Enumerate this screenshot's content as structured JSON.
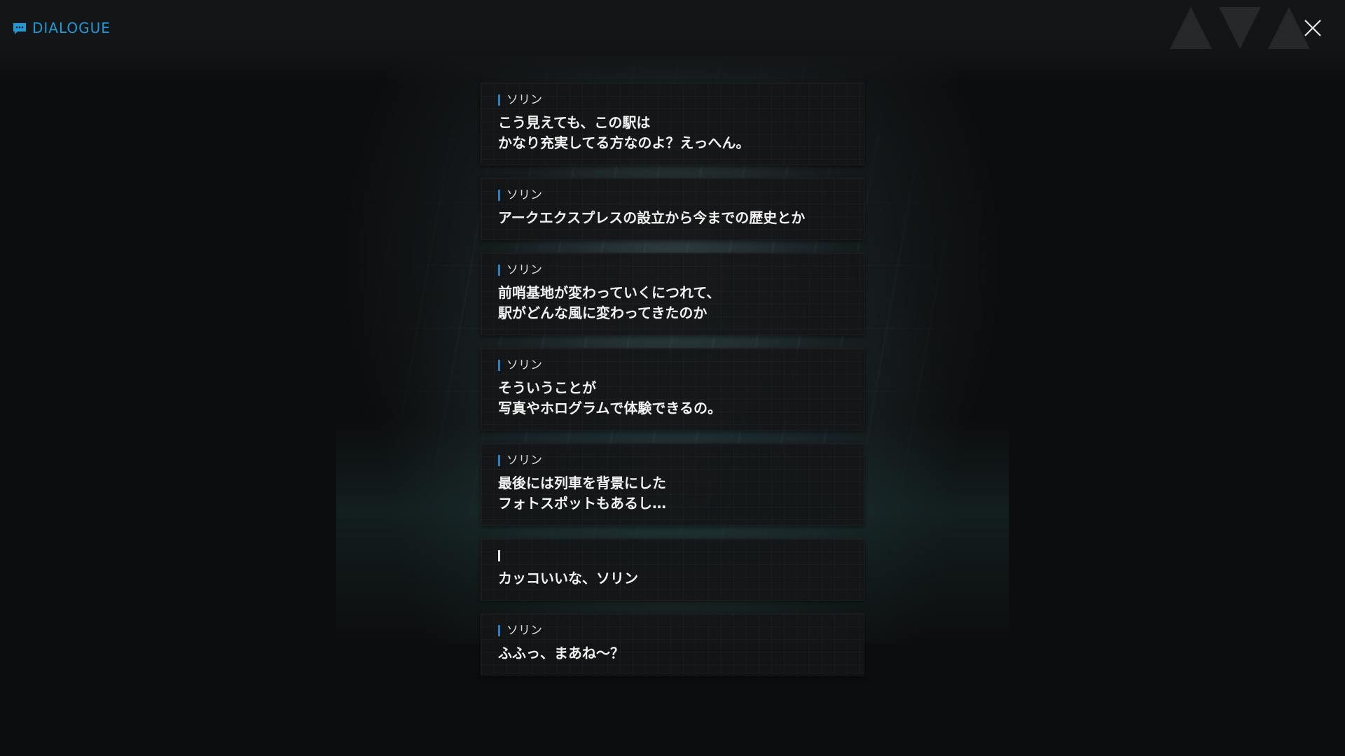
{
  "header": {
    "icon": "chat-bubble-icon",
    "title": "DIALOGUE",
    "accent_color": "#1e9bd7"
  },
  "close": {
    "icon": "close-icon"
  },
  "dialogue": [
    {
      "speaker": "ソリン",
      "lines": [
        "こう見えても、この駅は",
        "かなり充実してる方なのよ？えっへん。"
      ]
    },
    {
      "speaker": "ソリン",
      "lines": [
        "アークエクスプレスの設立から今までの歴史とか"
      ]
    },
    {
      "speaker": "ソリン",
      "lines": [
        "前哨基地が変わっていくにつれて、",
        "駅がどんな風に変わってきたのか"
      ]
    },
    {
      "speaker": "ソリン",
      "lines": [
        "そういうことが",
        "写真やホログラムで体験できるの。"
      ]
    },
    {
      "speaker": "ソリン",
      "lines": [
        "最後には列車を背景にした",
        "フォトスポットもあるし…"
      ]
    },
    {
      "speaker": "",
      "lines": [
        "カッコいいな、ソリン"
      ]
    },
    {
      "speaker": "ソリン",
      "lines": [
        "ふふっ、まあね～？"
      ]
    }
  ]
}
